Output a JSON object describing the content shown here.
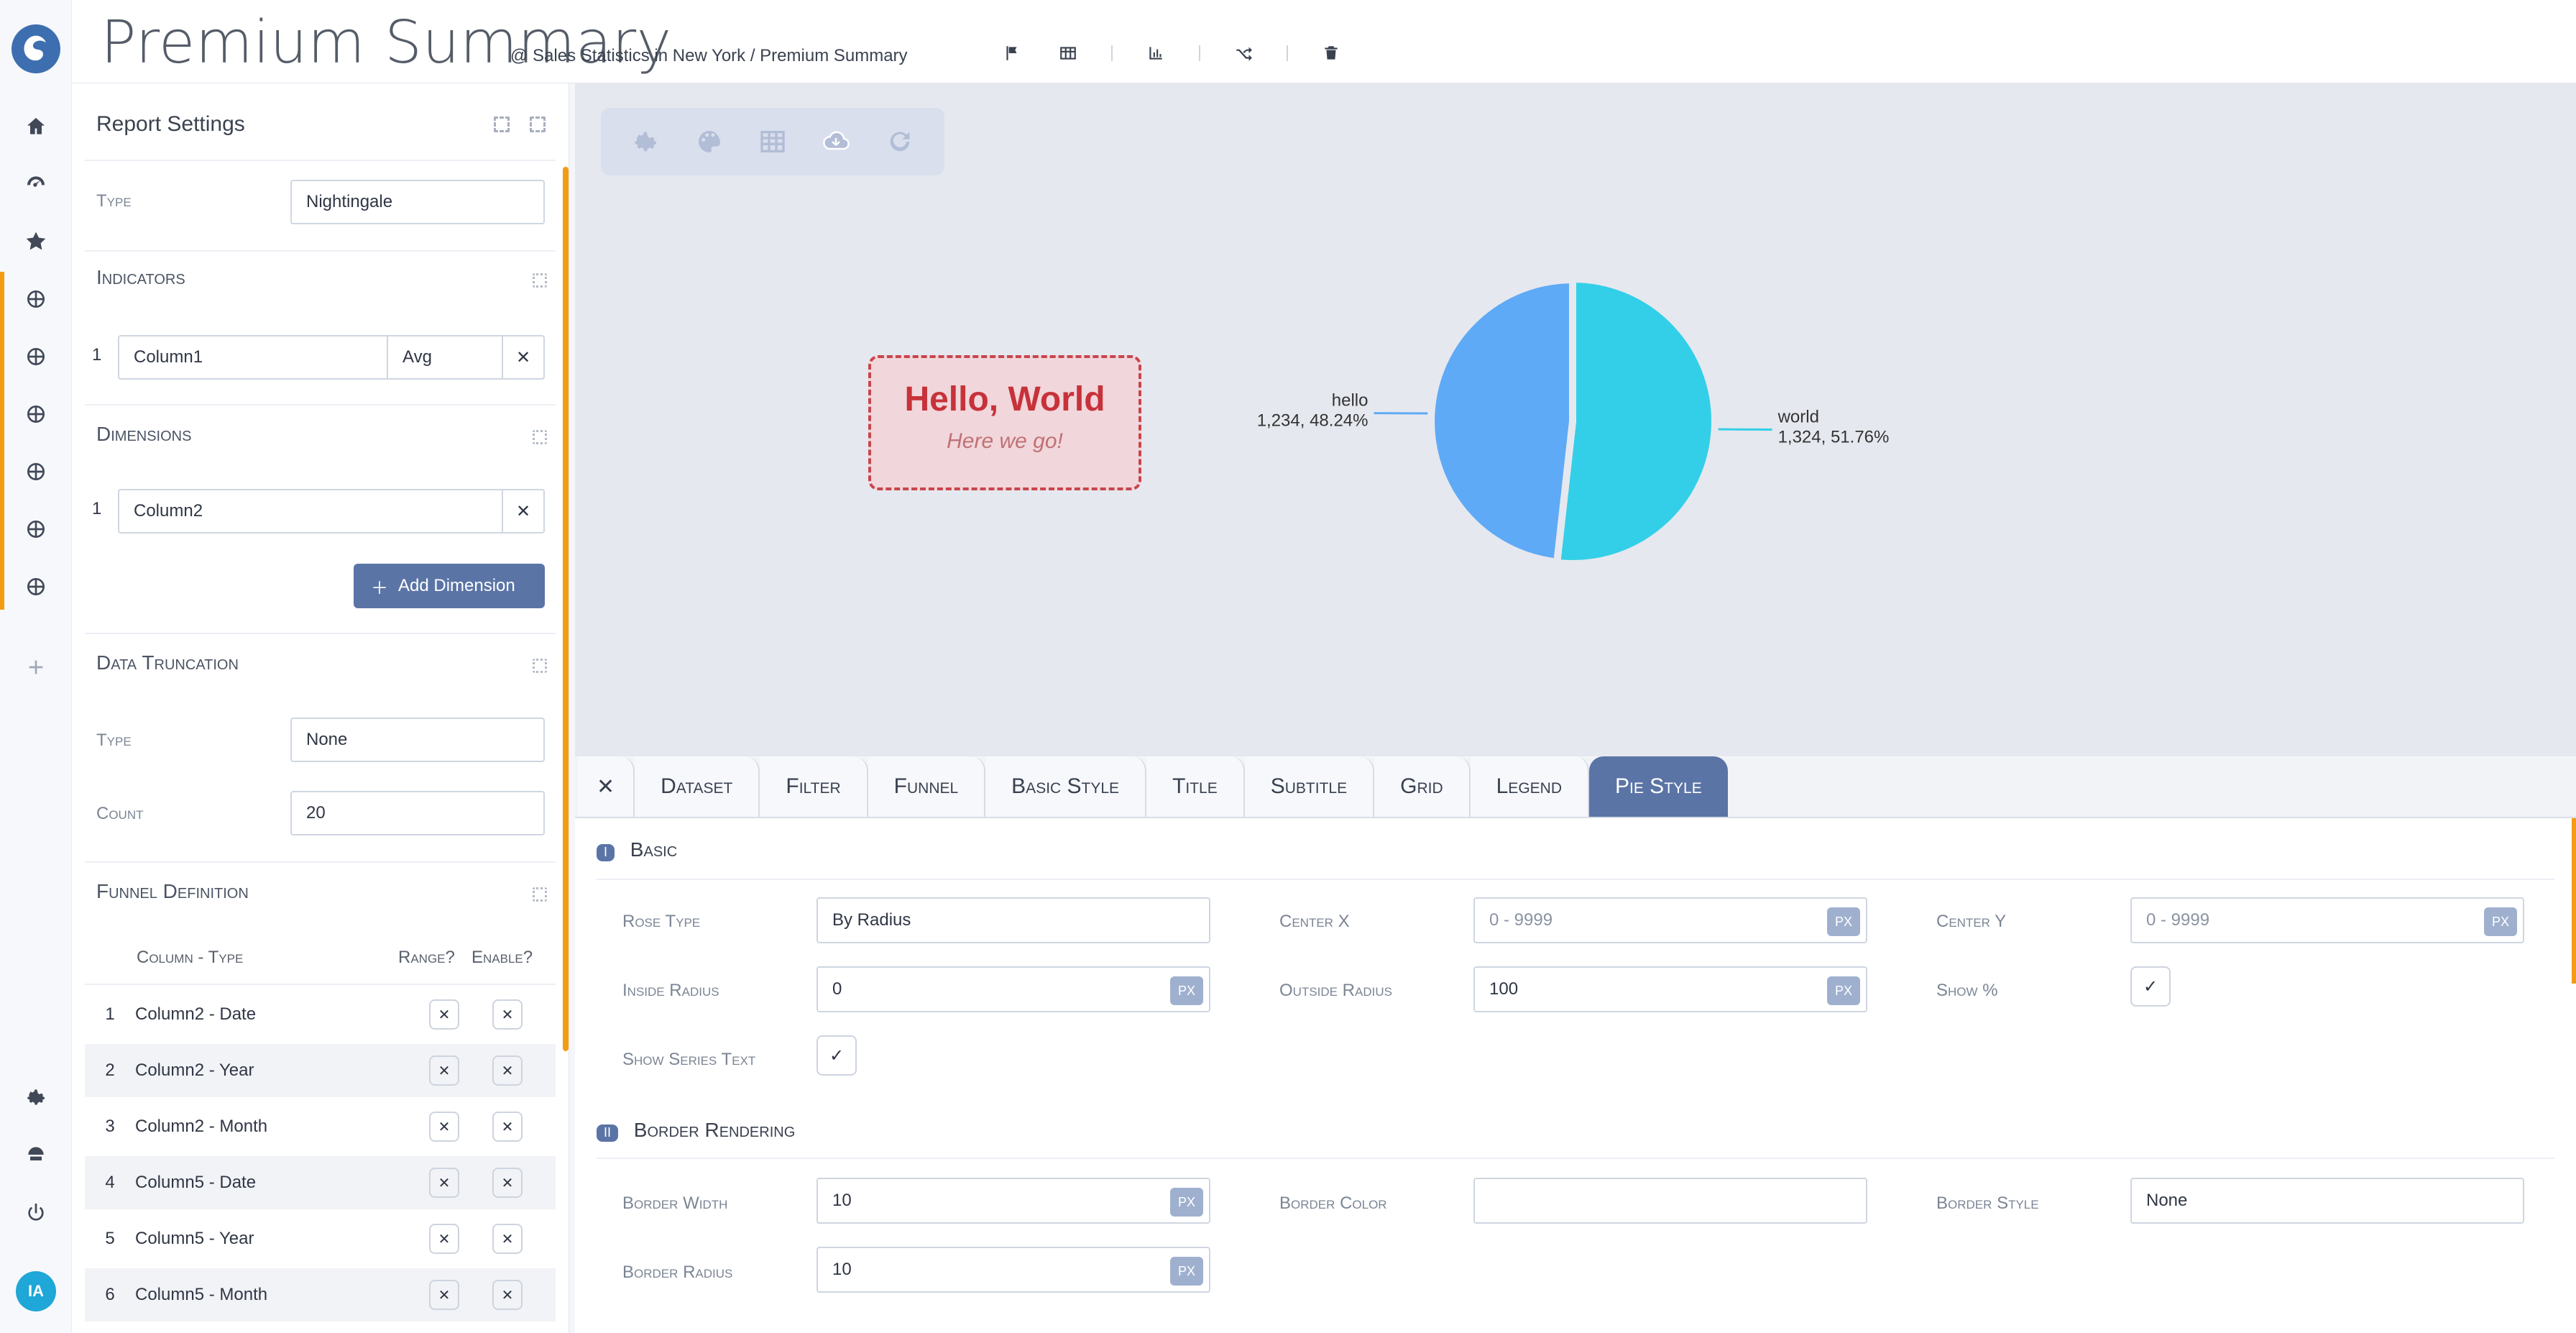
{
  "header": {
    "title": "Premium Summary",
    "breadcrumb": "@ Sales Statistics in New York / Premium Summary"
  },
  "settings": {
    "title": "Report Settings",
    "type_label": "Type",
    "type_value": "Nightingale",
    "indicators_title": "Indicators",
    "indicator_index": "1",
    "indicator_column": "Column1",
    "indicator_agg": "Avg",
    "dimensions_title": "Dimensions",
    "dimension_index": "1",
    "dimension_column": "Column2",
    "add_dimension_label": "Add Dimension",
    "data_truncation_title": "Data Truncation",
    "truncation_type_label": "Type",
    "truncation_type_value": "None",
    "count_label": "Count",
    "count_value": "20",
    "funnel_title": "Funnel Definition",
    "funnel_headers": [
      "Column - Type",
      "Range?",
      "Enable?"
    ],
    "funnel_rows": [
      {
        "idx": "1",
        "label": "Column2 - Date"
      },
      {
        "idx": "2",
        "label": "Column2 - Year"
      },
      {
        "idx": "3",
        "label": "Column2 - Month"
      },
      {
        "idx": "4",
        "label": "Column5 - Date"
      },
      {
        "idx": "5",
        "label": "Column5 - Year"
      },
      {
        "idx": "6",
        "label": "Column5 - Month"
      }
    ]
  },
  "chart_area": {
    "card_title": "Hello, World",
    "card_subtitle": "Here we go!"
  },
  "chart_data": {
    "type": "pie",
    "categories": [
      "world",
      "hello"
    ],
    "values": [
      1324,
      1234
    ],
    "percent_labels": [
      "51.76%",
      "48.24%"
    ],
    "labels": [
      {
        "name": "world",
        "value": "1,324",
        "percent": "51.76%",
        "side": "left"
      },
      {
        "name": "hello",
        "value": "1,234",
        "percent": "48.24%",
        "side": "right"
      }
    ],
    "colors": [
      "#33cfe8",
      "#5faaf6"
    ]
  },
  "tabs": [
    {
      "label": "Dataset"
    },
    {
      "label": "Filter"
    },
    {
      "label": "Funnel"
    },
    {
      "label": "Basic Style"
    },
    {
      "label": "Title"
    },
    {
      "label": "Subtitle"
    },
    {
      "label": "Grid"
    },
    {
      "label": "Legend"
    },
    {
      "label": "Pie Style",
      "active": true
    }
  ],
  "pie_style": {
    "basic": {
      "badge": "I",
      "title": "Basic",
      "rose_type_label": "Rose Type",
      "rose_type_value": "By Radius",
      "center_x_label": "Center X",
      "center_x_placeholder": "0 - 9999",
      "center_y_label": "Center Y",
      "center_y_placeholder": "0 - 9999",
      "inside_radius_label": "Inside Radius",
      "inside_radius_value": "0",
      "outside_radius_label": "Outside Radius",
      "outside_radius_value": "100",
      "show_percent_label": "Show %",
      "show_series_text_label": "Show Series Text",
      "px": "PX"
    },
    "border": {
      "badge": "II",
      "title": "Border Rendering",
      "border_width_label": "Border Width",
      "border_width_value": "10",
      "border_color_label": "Border Color",
      "border_style_label": "Border Style",
      "border_style_value": "None",
      "border_radius_label": "Border Radius",
      "border_radius_value": "10",
      "px": "PX"
    }
  },
  "colors": {
    "primary": "#5b74a6",
    "accent": "#f39c12",
    "chart_bg": "#e6e8ef",
    "hello_border": "#c8454c",
    "hello_bg": "#f1d6db"
  }
}
